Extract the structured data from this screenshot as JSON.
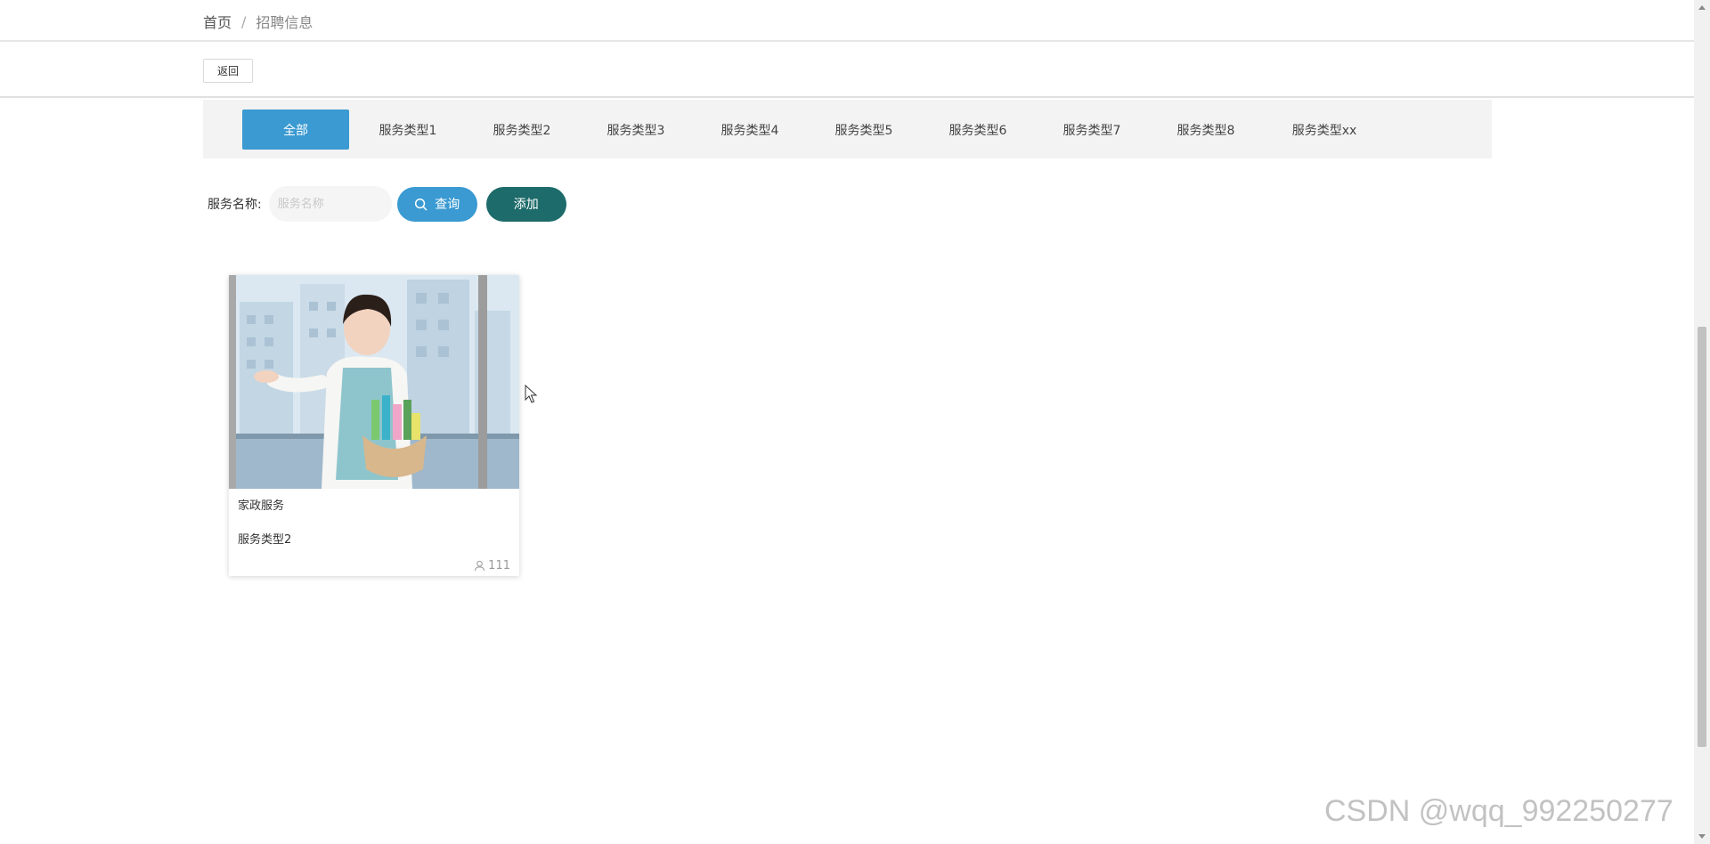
{
  "breadcrumb": {
    "home": "首页",
    "separator": "/",
    "current": "招聘信息"
  },
  "back_button": {
    "label": "返回"
  },
  "tabs": [
    {
      "label": "全部",
      "active": true
    },
    {
      "label": "服务类型1",
      "active": false
    },
    {
      "label": "服务类型2",
      "active": false
    },
    {
      "label": "服务类型3",
      "active": false
    },
    {
      "label": "服务类型4",
      "active": false
    },
    {
      "label": "服务类型5",
      "active": false
    },
    {
      "label": "服务类型6",
      "active": false
    },
    {
      "label": "服务类型7",
      "active": false
    },
    {
      "label": "服务类型8",
      "active": false
    },
    {
      "label": "服务类型xx",
      "active": false
    }
  ],
  "search": {
    "label": "服务名称:",
    "placeholder": "服务名称",
    "value": "",
    "query_label": "查询",
    "add_label": "添加"
  },
  "cards": [
    {
      "title": "家政服务",
      "type": "服务类型2",
      "views": "111",
      "image": "housekeeping-woman-with-cleaning-basket"
    }
  ],
  "watermark": "CSDN @wqq_992250277",
  "colors": {
    "primary": "#3a9ad1",
    "add_button": "#1d6b6a",
    "tabs_background": "#f3f3f3"
  }
}
